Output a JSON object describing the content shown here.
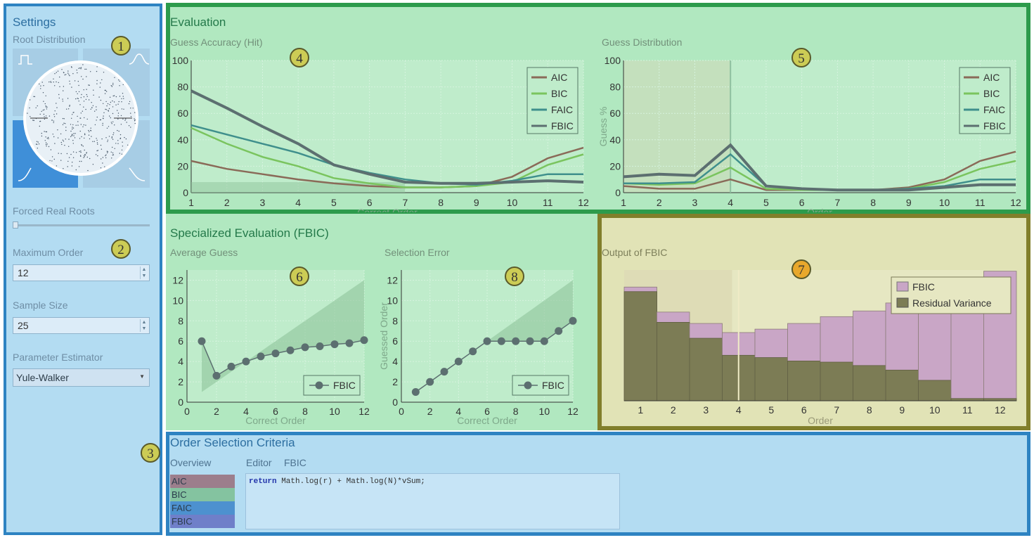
{
  "colors": {
    "aic": "#8a6a58",
    "bic": "#7ac45e",
    "faic": "#3f8f8c",
    "fbic": "#5c6f70",
    "fbic_bar": "#c9a6c6",
    "resid_bar": "#7c7c55"
  },
  "settings": {
    "title": "Settings",
    "root_dist_label": "Root Distribution",
    "forced_real_label": "Forced Real Roots",
    "max_order_label": "Maximum Order",
    "max_order_value": "12",
    "sample_size_label": "Sample Size",
    "sample_size_value": "25",
    "estimator_label": "Parameter Estimator",
    "estimator_value": "Yule-Walker",
    "forced_real_value": 0
  },
  "badges": {
    "b1": "1",
    "b2": "2",
    "b3": "3",
    "b4": "4",
    "b5": "5",
    "b6": "6",
    "b7": "7",
    "b8": "8"
  },
  "evaluation": {
    "title": "Evaluation"
  },
  "specialized": {
    "title": "Specialized Evaluation (FBIC)"
  },
  "criteria": {
    "title": "Order Selection Criteria",
    "tab_overview": "Overview",
    "tab_editor": "Editor",
    "tab_fbic": "FBIC",
    "items": [
      "AIC",
      "BIC",
      "FAIC",
      "FBIC"
    ],
    "item_colors": [
      "#9c7e8c",
      "#84c3a0",
      "#4d91cf",
      "#6f7fc9"
    ],
    "code_kw": "return",
    "code_rest": " Math.log(r) + Math.log(N)*vSum;"
  },
  "chart_data": [
    {
      "type": "line",
      "title": "Guess Accuracy (Hit)",
      "xlabel": "Correct Order",
      "ylabel": "",
      "x": [
        1,
        2,
        3,
        4,
        5,
        6,
        7,
        8,
        9,
        10,
        11,
        12
      ],
      "ylim": [
        0,
        100
      ],
      "yticks": [
        0,
        20,
        40,
        60,
        80,
        100
      ],
      "series": [
        {
          "name": "AIC",
          "values": [
            24,
            18,
            14,
            10,
            7,
            5,
            4,
            4,
            5,
            12,
            26,
            34
          ]
        },
        {
          "name": "BIC",
          "values": [
            49,
            37,
            27,
            20,
            11,
            7,
            4,
            4,
            5,
            8,
            21,
            29
          ]
        },
        {
          "name": "FAIC",
          "values": [
            51,
            44,
            37,
            30,
            21,
            15,
            10,
            7,
            6,
            9,
            14,
            14
          ]
        },
        {
          "name": "FBIC",
          "values": [
            77,
            64,
            50,
            37,
            21,
            14,
            8,
            7,
            7,
            8,
            9,
            8
          ]
        }
      ],
      "legend": "top-right",
      "grid": true
    },
    {
      "type": "line",
      "title": "Guess Distribution",
      "xlabel": "Order",
      "ylabel": "Guess %",
      "x": [
        1,
        2,
        3,
        4,
        5,
        6,
        7,
        8,
        9,
        10,
        11,
        12
      ],
      "ylim": [
        0,
        100
      ],
      "yticks": [
        0,
        20,
        40,
        60,
        80,
        100
      ],
      "marker_x": 4,
      "series": [
        {
          "name": "AIC",
          "values": [
            5,
            3,
            3,
            10,
            2,
            2,
            2,
            2,
            4,
            10,
            24,
            31
          ]
        },
        {
          "name": "BIC",
          "values": [
            7,
            6,
            7,
            19,
            3,
            2,
            2,
            2,
            3,
            8,
            18,
            24
          ]
        },
        {
          "name": "FAIC",
          "values": [
            7,
            7,
            8,
            29,
            5,
            3,
            2,
            2,
            3,
            5,
            10,
            10
          ]
        },
        {
          "name": "FBIC",
          "values": [
            12,
            14,
            13,
            36,
            5,
            3,
            2,
            2,
            2,
            4,
            6,
            6
          ]
        }
      ],
      "legend": "top-right",
      "grid": true
    },
    {
      "type": "line",
      "title": "Average Guess",
      "xlabel": "Correct Order",
      "ylabel": "",
      "x": [
        1,
        2,
        3,
        4,
        5,
        6,
        7,
        8,
        9,
        10,
        11,
        12
      ],
      "ylim": [
        0,
        13
      ],
      "yticks": [
        0,
        2,
        4,
        6,
        8,
        10,
        12
      ],
      "xticks": [
        0,
        2,
        4,
        6,
        8,
        10,
        12
      ],
      "series": [
        {
          "name": "FBIC",
          "values": [
            6,
            2.6,
            3.5,
            4,
            4.5,
            4.8,
            5.1,
            5.4,
            5.5,
            5.7,
            5.8,
            6.1
          ]
        }
      ],
      "legend": "bottom-right",
      "grid": true
    },
    {
      "type": "line",
      "title": "Selection Error",
      "xlabel": "Correct Order",
      "ylabel": "Guessed Order",
      "x": [
        1,
        2,
        3,
        4,
        5,
        6,
        7,
        8,
        9,
        10,
        11,
        12
      ],
      "ylim": [
        0,
        13
      ],
      "yticks": [
        0,
        2,
        4,
        6,
        8,
        10,
        12
      ],
      "xticks": [
        0,
        2,
        4,
        6,
        8,
        10,
        12
      ],
      "series": [
        {
          "name": "FBIC",
          "values": [
            1,
            2,
            3,
            4,
            5,
            6,
            6,
            6,
            6,
            6,
            7,
            8
          ]
        }
      ],
      "legend": "bottom-right",
      "grid": true
    },
    {
      "type": "bar",
      "title": "Output of FBIC",
      "xlabel": "Order",
      "ylabel": "",
      "categories": [
        "1",
        "2",
        "3",
        "4",
        "5",
        "6",
        "7",
        "8",
        "9",
        "10",
        "11",
        "12"
      ],
      "marker_x": 4,
      "series": [
        {
          "name": "FBIC",
          "values": [
            100,
            78,
            68,
            60,
            63,
            68,
            74,
            79,
            86,
            93,
            99,
            114
          ]
        },
        {
          "name": "Residual Variance",
          "values": [
            96,
            69,
            55,
            40,
            38,
            35,
            34,
            31,
            27,
            18,
            2,
            2
          ]
        }
      ],
      "legend": "top-right",
      "grid": true
    }
  ]
}
